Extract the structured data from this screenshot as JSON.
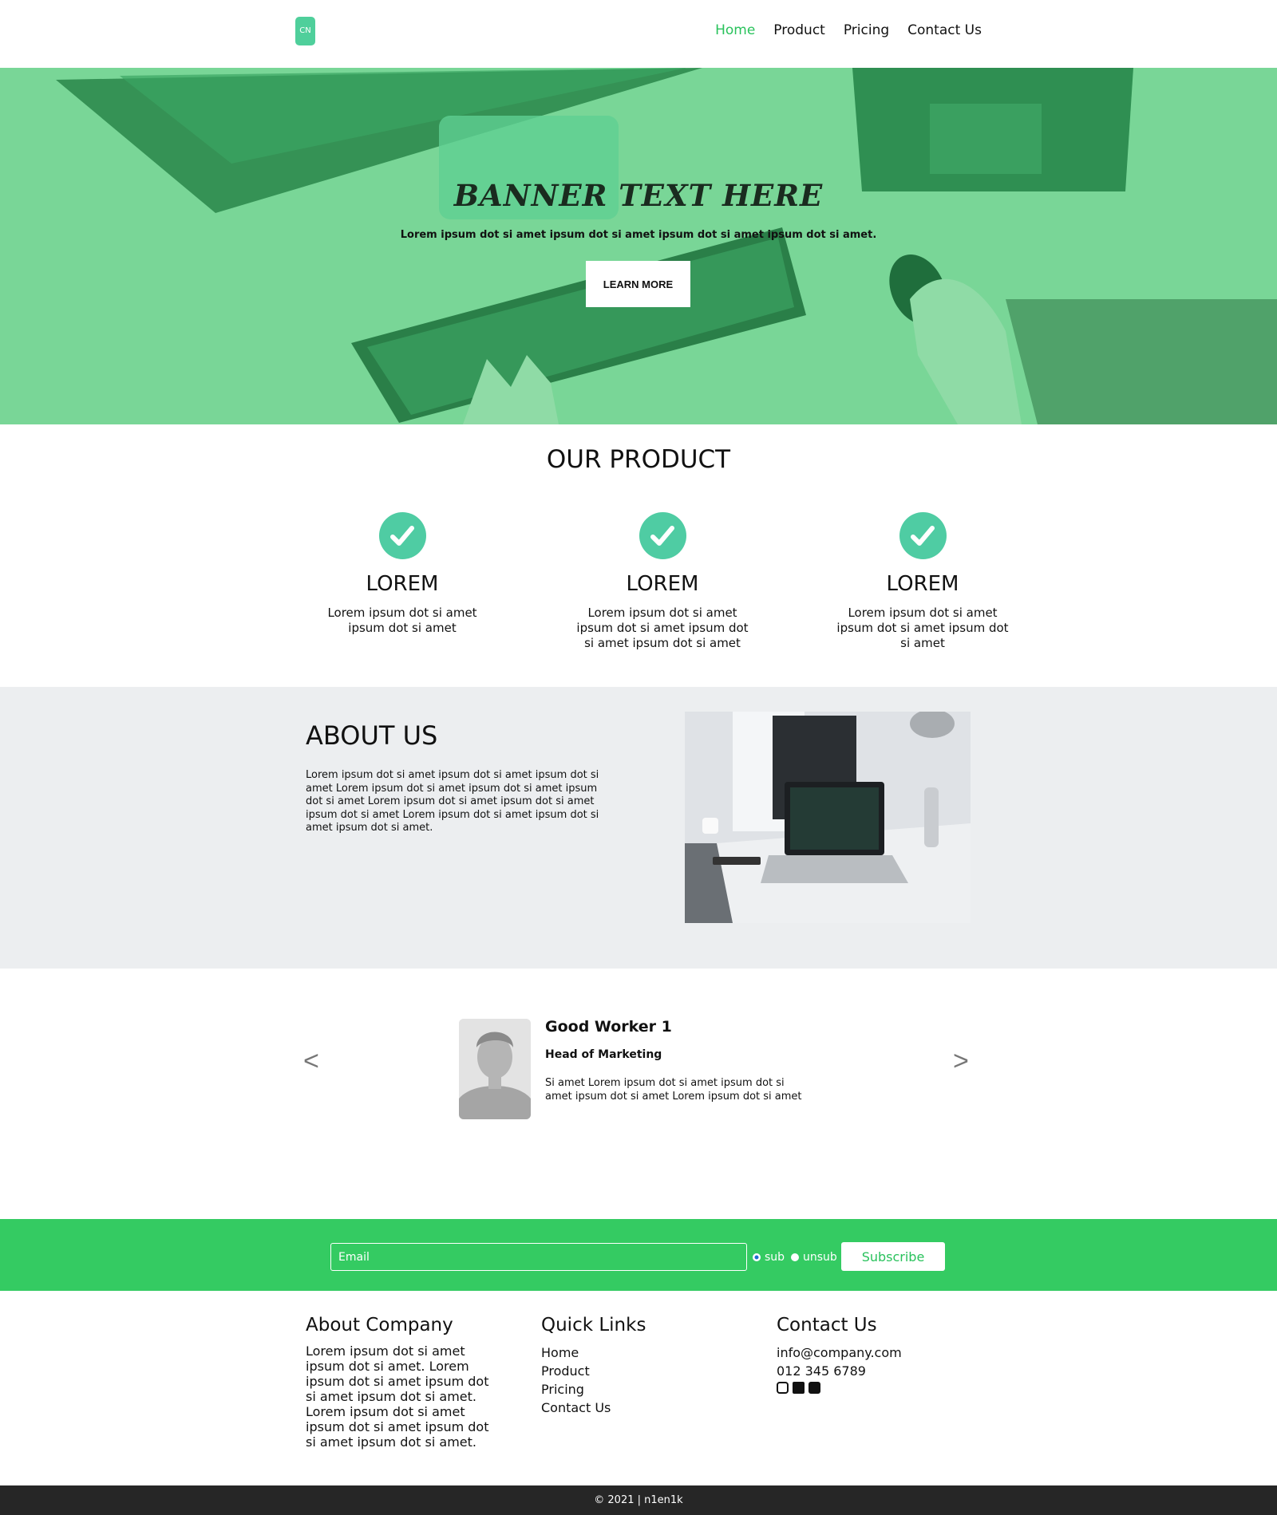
{
  "nav": {
    "logo_text": "CN",
    "items": [
      {
        "label": "Home",
        "active": true
      },
      {
        "label": "Product",
        "active": false
      },
      {
        "label": "Pricing",
        "active": false
      },
      {
        "label": "Contact Us",
        "active": false
      }
    ]
  },
  "hero": {
    "title": "BANNER TEXT HERE",
    "subtitle": "Lorem ipsum dot si amet ipsum dot si amet ipsum dot si amet ipsum dot si amet.",
    "button": "LEARN MORE",
    "overlay_color": "#79d697"
  },
  "product": {
    "title": "OUR PRODUCT",
    "features": [
      {
        "icon": "check-circle-icon",
        "title": "LOREM",
        "text": "Lorem ipsum dot si amet ipsum dot si amet"
      },
      {
        "icon": "check-circle-icon",
        "title": "LOREM",
        "text": "Lorem ipsum dot si amet ipsum dot si amet ipsum dot si amet ipsum dot si amet"
      },
      {
        "icon": "check-circle-icon",
        "title": "LOREM",
        "text": "Lorem ipsum dot si amet ipsum dot si amet ipsum dot si amet"
      }
    ]
  },
  "about": {
    "title": "ABOUT US",
    "text": "Lorem ipsum dot si amet ipsum dot si amet ipsum dot si amet Lorem ipsum dot si amet ipsum dot si amet ipsum dot si amet Lorem ipsum dot si amet ipsum dot si amet ipsum dot si amet Lorem ipsum dot si amet ipsum dot si amet ipsum dot si amet."
  },
  "testimonial": {
    "prev": "<",
    "next": ">",
    "name": "Good Worker 1",
    "role": "Head of Marketing",
    "text": "Si amet Lorem ipsum dot si amet ipsum dot si amet ipsum dot si amet Lorem ipsum dot si amet"
  },
  "subscribe": {
    "email_placeholder": "Email",
    "options": [
      {
        "label": "sub",
        "selected": true
      },
      {
        "label": "unsub",
        "selected": false
      }
    ],
    "button": "Subscribe"
  },
  "footer": {
    "about": {
      "title": "About Company",
      "text": "Lorem ipsum dot si amet ipsum dot si amet. Lorem ipsum dot si amet ipsum dot si amet ipsum dot si amet. Lorem ipsum dot si amet ipsum dot si amet ipsum dot si amet ipsum dot si amet."
    },
    "links": {
      "title": "Quick Links",
      "items": [
        "Home",
        "Product",
        "Pricing",
        "Contact Us"
      ]
    },
    "contact": {
      "title": "Contact Us",
      "email": "info@company.com",
      "phone": "012 345 6789",
      "social_icons": [
        "instagram-icon",
        "facebook-icon",
        "snapchat-icon"
      ]
    }
  },
  "copyright": "© 2021 | n1en1k",
  "colors": {
    "accent": "#29c25c",
    "subscribe_bg": "#34cb62",
    "check_bg": "#4fcca3",
    "about_bg": "#eceef0",
    "bottom_bar": "#262626"
  }
}
